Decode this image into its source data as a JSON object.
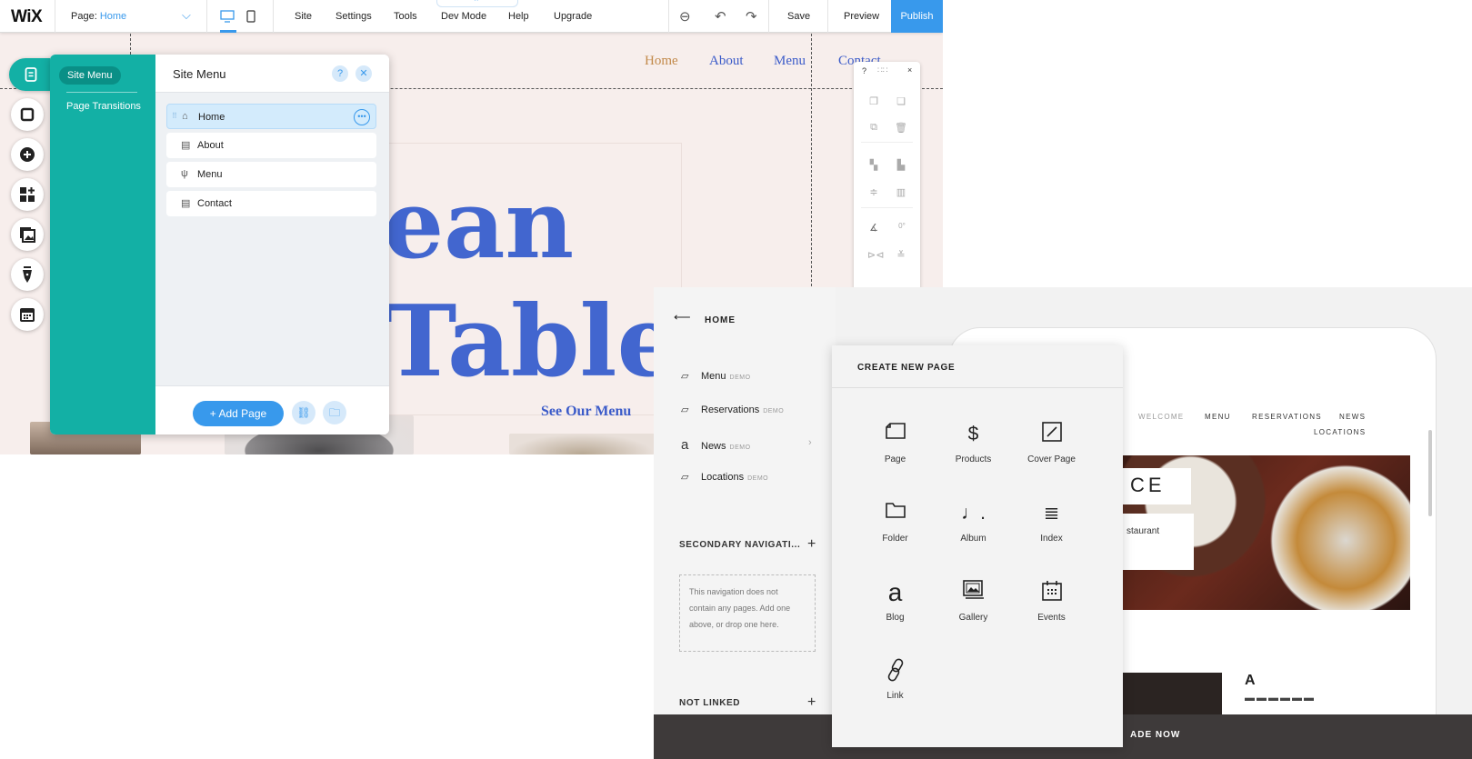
{
  "wix": {
    "logo": "WiX",
    "page_selector": {
      "prefix": "Page:",
      "value": "Home"
    },
    "menu": [
      "Site",
      "Settings",
      "Tools",
      "Dev Mode",
      "Help",
      "Upgrade"
    ],
    "save": "Save",
    "preview": "Preview",
    "publish": "Publish",
    "site_nav": [
      "Home",
      "About",
      "Menu",
      "Contact"
    ],
    "hero_line1": "ean",
    "hero_line2": "Table",
    "see_menu": "See Our Menu",
    "site_menu_panel": {
      "tab_active": "Site Menu",
      "tab_other": "Page Transitions",
      "title": "Site Menu",
      "pages": [
        {
          "label": "Home",
          "icon": "home-icon"
        },
        {
          "label": "About",
          "icon": "page-icon"
        },
        {
          "label": "Menu",
          "icon": "fork-knife-icon"
        },
        {
          "label": "Contact",
          "icon": "page-icon"
        }
      ],
      "add_page": "+ Add Page"
    },
    "toolbar": {
      "help": "?",
      "close": "×",
      "rotation": "0°"
    }
  },
  "squarespace": {
    "back_label": "HOME",
    "nav_items": [
      {
        "label": "Menu",
        "badge": "DEMO"
      },
      {
        "label": "Reservations",
        "badge": "DEMO"
      },
      {
        "label": "News",
        "badge": "DEMO"
      },
      {
        "label": "Locations",
        "badge": "DEMO"
      }
    ],
    "secondary_nav": "SECONDARY NAVIGATI...",
    "secondary_note": "This navigation does not contain any pages. Add one above, or drop one here.",
    "not_linked": "NOT LINKED",
    "create_new_page": {
      "title": "CREATE NEW PAGE",
      "tiles": [
        "Page",
        "Products",
        "Cover Page",
        "Folder",
        "Album",
        "Index",
        "Blog",
        "Gallery",
        "Events",
        "Link"
      ]
    },
    "preview": {
      "nav": [
        "WELCOME",
        "MENU",
        "RESERVATIONS",
        "NEWS",
        "LOCATIONS"
      ],
      "space_word": "CE",
      "restaurant_word": "staurant",
      "a_word": "A",
      "upgrade": "ADE NOW"
    }
  }
}
